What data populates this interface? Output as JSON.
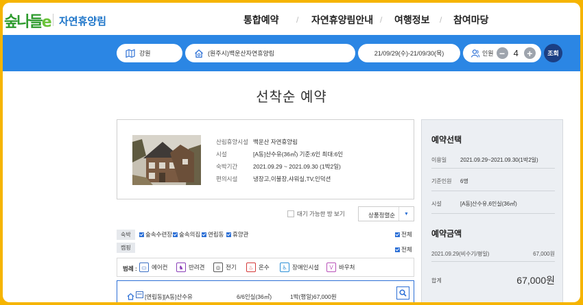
{
  "header": {
    "logo": {
      "text_main": "숲나들",
      "text_e": "e"
    },
    "site_name": "자연휴양림",
    "nav": [
      "통합예약",
      "자연휴양림안내",
      "여행정보",
      "참여마당"
    ],
    "nav_sep": "/"
  },
  "search": {
    "region": "강원",
    "forest": "(원주시)백운산자연휴양림",
    "dates": "21/09/29(수)-21/09/30(목)",
    "people_label": "인원",
    "minus": "−",
    "plus": "+",
    "people_count": "4",
    "search_button": "조회"
  },
  "page_title": "선착순 예약",
  "facility": {
    "rows": [
      {
        "label": "산림휴양시설",
        "value": "백운산 자연휴양림"
      },
      {
        "label": "시설",
        "value": "[A동]산수유(36㎡) 기준:6인 최대:6인"
      },
      {
        "label": "숙박기간",
        "value": "2021.09.29 ~ 2021.09.30 (1박2일)"
      },
      {
        "label": "편의시설",
        "value": "냉장고,이불장,샤워실,TV,인덕션"
      }
    ]
  },
  "summary": {
    "select_title": "예약선택",
    "select_rows": [
      {
        "label": "이용일",
        "value": "2021.09.29~2021.09.30(1박2일)"
      },
      {
        "label": "기준인원",
        "value": "6명"
      },
      {
        "label": "시설",
        "value": "[A동]산수유,6인실(36㎡)"
      }
    ],
    "price_title": "예약금액",
    "price_line": {
      "label": "2021.09.29(비수기/평일)",
      "value": "67,000원"
    },
    "total": {
      "label": "합계",
      "value": "67,000원"
    }
  },
  "filters": {
    "waitlist_label": "대기 가능한 방 보기",
    "sort_label": "상품정렬순",
    "sort_arrow": "▼",
    "lodging_tag": "숙박",
    "camping_tag": "캠핑",
    "lodging_options": [
      "숲속수련장",
      "숲속의집",
      "연립동",
      "휴양관"
    ],
    "all_label": "전체"
  },
  "legend": {
    "title": "범례 :",
    "items": [
      {
        "label": "에어컨",
        "icon": "air-conditioner-icon",
        "color": "#3a6fc4"
      },
      {
        "label": "반려견",
        "icon": "pet-icon",
        "color": "#8a3fb8"
      },
      {
        "label": "전기",
        "icon": "electricity-icon",
        "color": "#555555"
      },
      {
        "label": "온수",
        "icon": "hot-water-icon",
        "color": "#d43838"
      },
      {
        "label": "장애인시설",
        "icon": "accessibility-icon",
        "color": "#2b8fd6"
      },
      {
        "label": "바우처",
        "icon": "voucher-icon",
        "color": "#b84fb8"
      }
    ]
  },
  "result": {
    "name": "[연립동][A동]산수유",
    "capacity": "6/6인실(36㎡)",
    "price": "1박(평일)67,000원"
  },
  "colors": {
    "brand_green": "#2e9b2e",
    "accent_blue": "#2b86e4",
    "navy": "#1b3f84",
    "frame": "#f6b400"
  }
}
